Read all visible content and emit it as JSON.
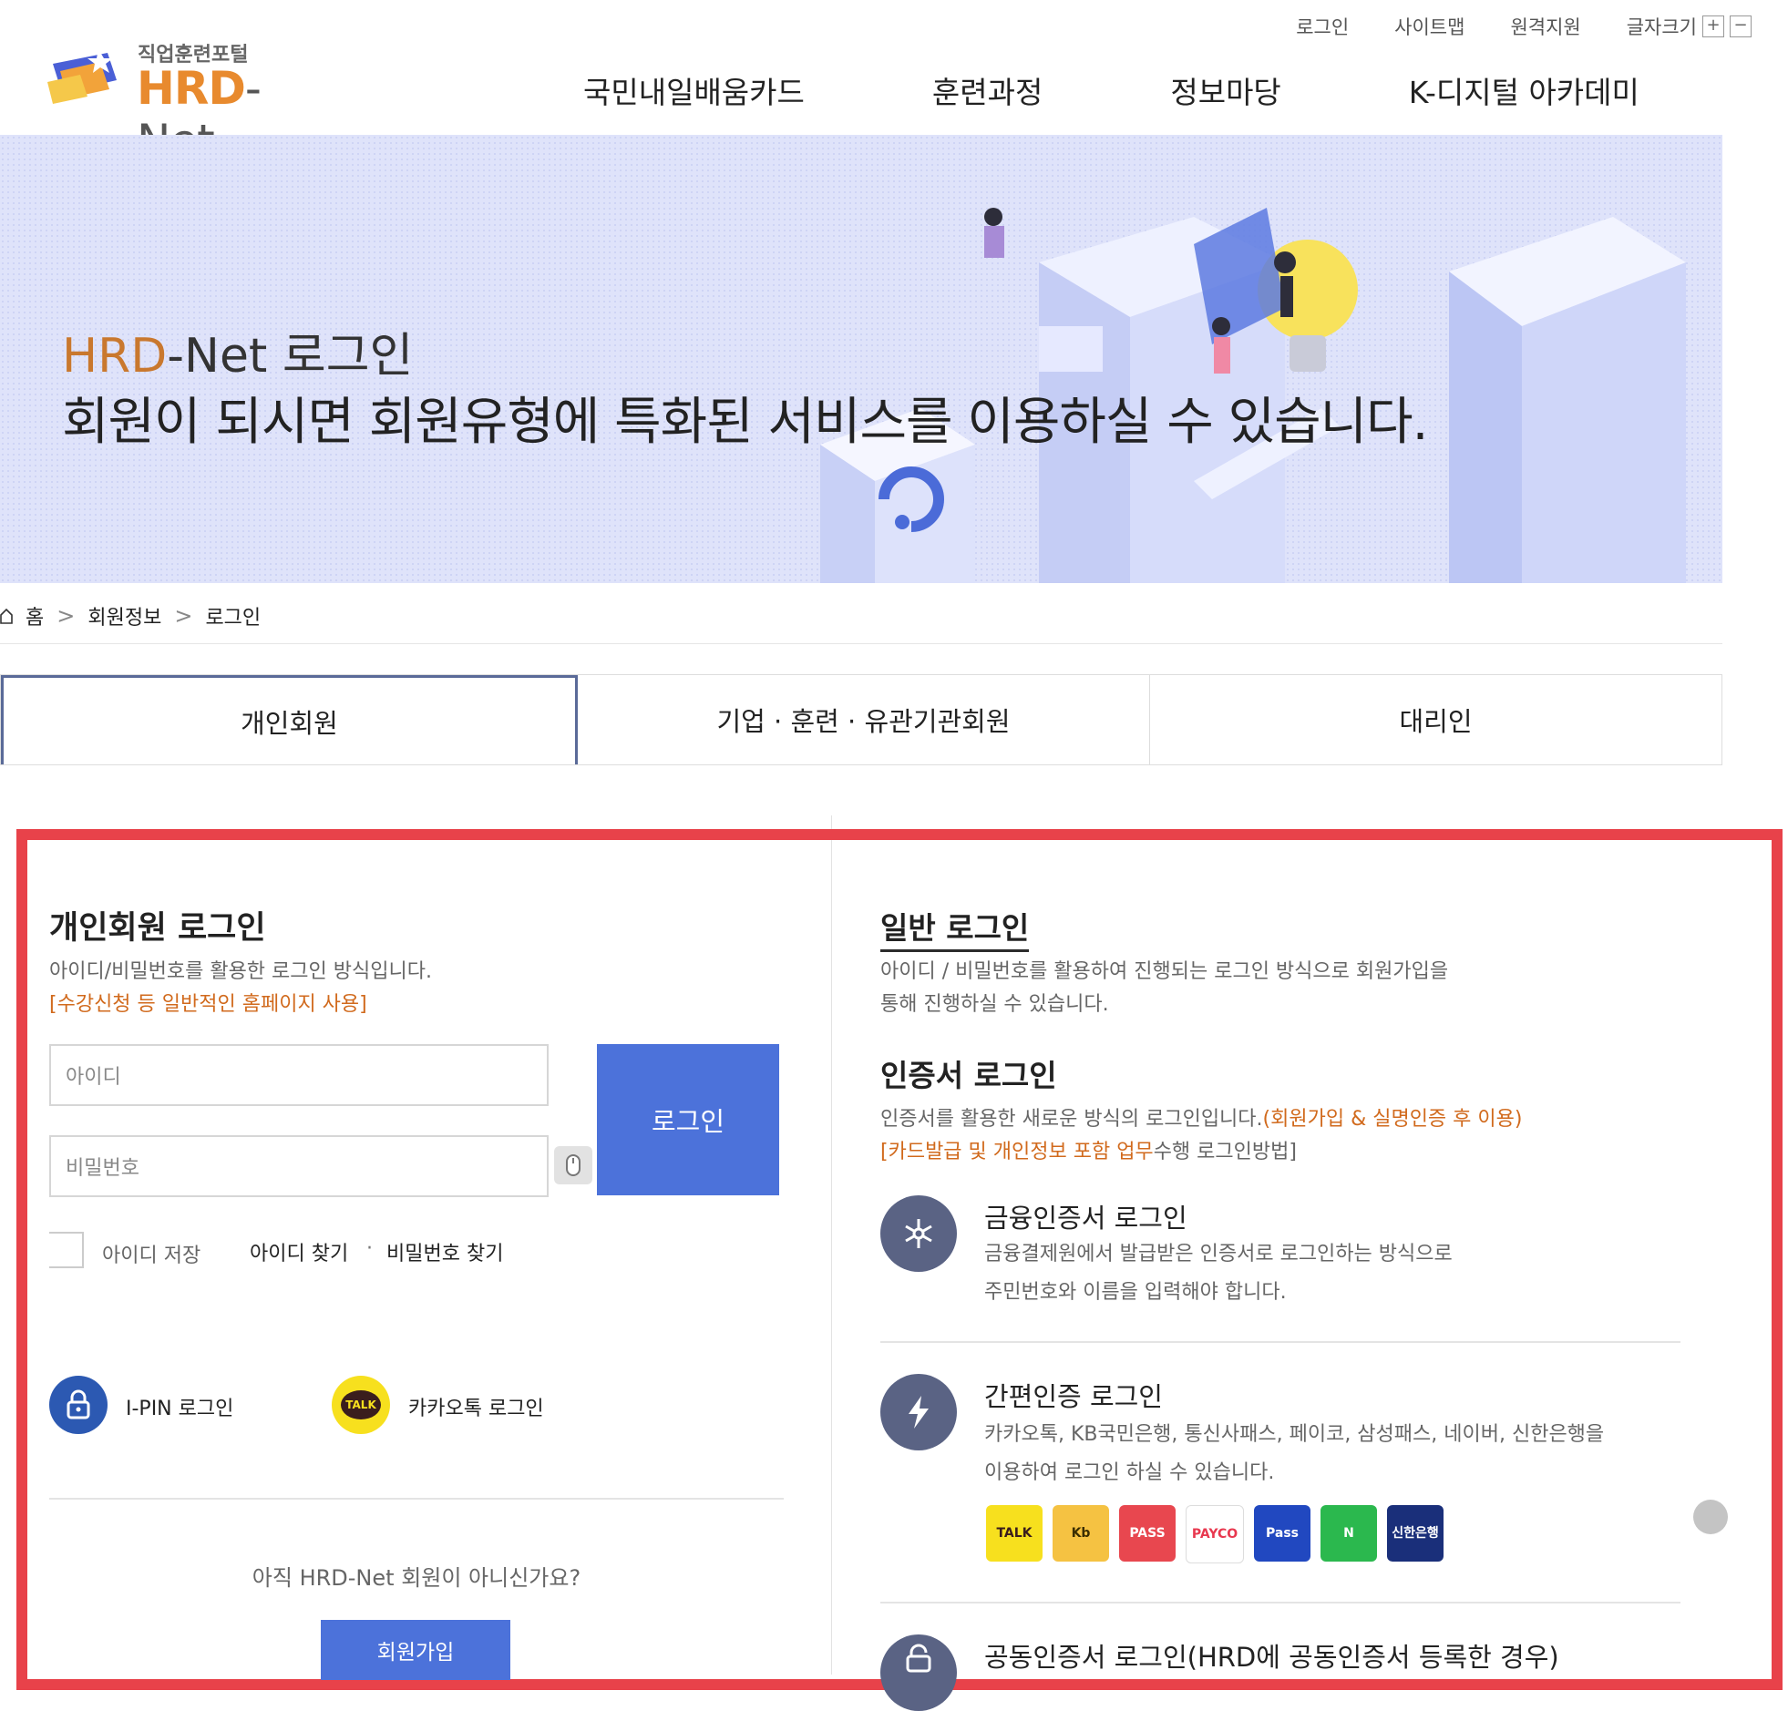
{
  "util": {
    "login": "로그인",
    "sitemap": "사이트맵",
    "remote": "원격지원",
    "fontsize": "글자크기",
    "plus": "+",
    "minus": "−"
  },
  "logo": {
    "sub": "직업훈련포털",
    "main": "HRD",
    "dash": "- Net"
  },
  "nav": [
    "국민내일배움카드",
    "훈련과정",
    "정보마당",
    "K-디지털 아카데미"
  ],
  "hero": {
    "title_o": "HRD",
    "title_rest": "-Net 로그인",
    "subtitle": "회원이 되시면 회원유형에 특화된 서비스를 이용하실 수 있습니다."
  },
  "breadcrumb": {
    "home": "홈",
    "level1": "회원정보",
    "level2": "로그인",
    "sep": ">"
  },
  "tabs": [
    "개인회원",
    "기업 · 훈련 · 유관기관회원",
    "대리인"
  ],
  "left": {
    "title": "개인회원 로그인",
    "desc": "아이디/비밀번호를 활용한 로그인 방식입니다.",
    "note": "[수강신청 등 일반적인 홈페이지 사용]",
    "id_placeholder": "아이디",
    "pw_placeholder": "비밀번호",
    "login_btn": "로그인",
    "save_id": "아이디 저장",
    "find_id": "아이디 찾기",
    "dot": "·",
    "find_pw": "비밀번호 찾기",
    "ipin": "I-PIN 로그인",
    "kakao": "카카오톡 로그인",
    "talk_badge": "TALK",
    "not_member": "아직 HRD-Net 회원이 아니신가요?",
    "join_btn": "회원가입"
  },
  "right": {
    "general_title": "일반 로그인",
    "general_desc1": "아이디 / 비밀번호를 활용하여 진행되는 로그인 방식으로 회원가입을",
    "general_desc2": "통해 진행하실 수 있습니다.",
    "cert_title": "인증서 로그인",
    "cert_desc": "인증서를 활용한 새로운 방식의 로그인입니다.",
    "cert_desc_o": "(회원가입 & 실명인증 후 이용)",
    "cert_note_o": "[카드발급 및 개인정보 포함 업무",
    "cert_note_rest": "수행 로그인방법]",
    "fin_title": "금융인증서 로그인",
    "fin_desc1": "금융결제원에서 발급받은 인증서로 로그인하는 방식으로",
    "fin_desc2": "주민번호와 이름을 입력해야 합니다.",
    "easy_title": "간편인증 로그인",
    "easy_desc1": "카카오톡, KB국민은행, 통신사패스, 페이코, 삼성패스, 네이버, 신한은행을",
    "easy_desc2": "이용하여 로그인 하실 수 있습니다.",
    "providers": [
      {
        "label": "TALK",
        "bg": "#f7e01e",
        "fg": "#3a1d1d"
      },
      {
        "label": "Kb",
        "bg": "#f5c242",
        "fg": "#3a2d00"
      },
      {
        "label": "PASS",
        "bg": "#e8474f",
        "fg": "#ffffff"
      },
      {
        "label": "PAYCO",
        "bg": "#ffffff",
        "fg": "#e8384f"
      },
      {
        "label": "Pass",
        "bg": "#2148c0",
        "fg": "#ffffff"
      },
      {
        "label": "N",
        "bg": "#2bb84e",
        "fg": "#ffffff"
      },
      {
        "label": "신한은행",
        "bg": "#1a2f7a",
        "fg": "#ffffff"
      }
    ],
    "joint_title": "공동인증서 로그인(HRD에 공동인증서 등록한 경우)"
  },
  "colors": {
    "accent": "#4c72da",
    "orange": "#d16a1d",
    "highlight": "#e8424a",
    "icon_dark": "#5a6384"
  }
}
